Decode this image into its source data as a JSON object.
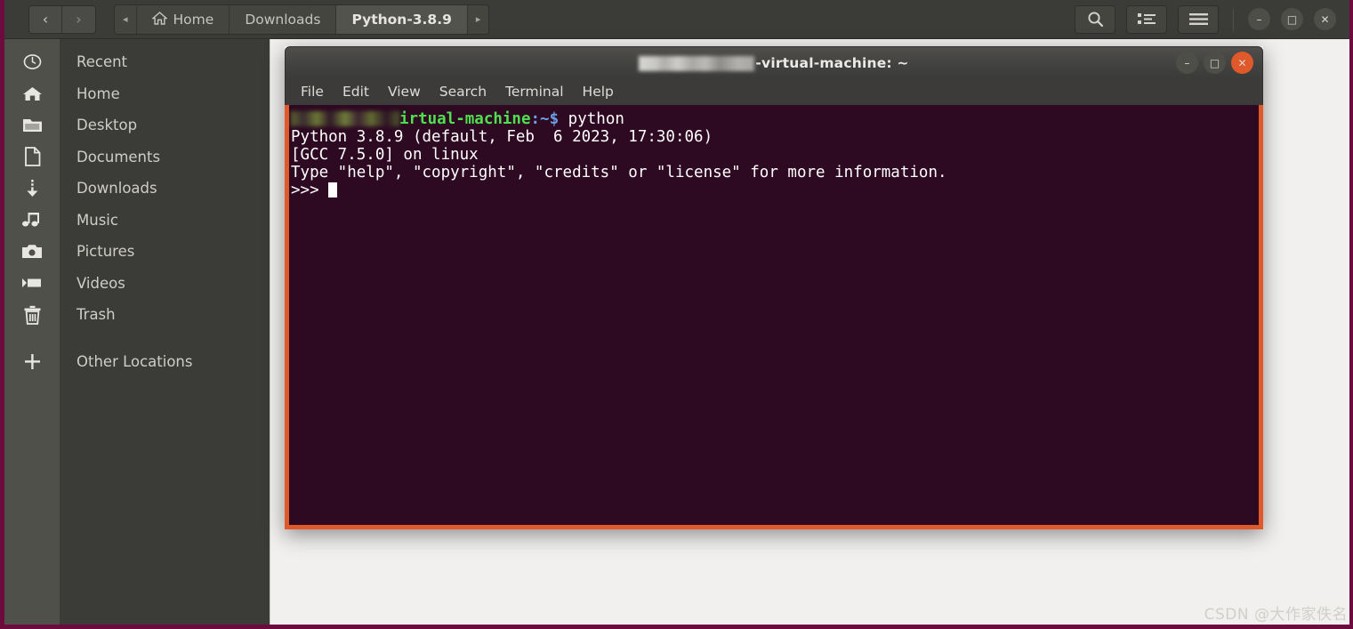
{
  "window": {
    "app": "Files",
    "background_color": "#f1f0ee",
    "frame_color": "#6d0b3e",
    "header_color": "#3b3b38"
  },
  "header": {
    "nav": {
      "back_label": "‹",
      "forward_label": "›"
    },
    "breadcrumb": {
      "prev_arrow": "◂",
      "next_arrow": "▸",
      "items": [
        {
          "label": "Home",
          "icon": "home-icon",
          "current": false
        },
        {
          "label": "Downloads",
          "icon": "",
          "current": false
        },
        {
          "label": "Python-3.8.9",
          "icon": "",
          "current": true
        }
      ]
    },
    "tools": [
      {
        "name": "search-icon",
        "label": ""
      },
      {
        "name": "view-list-icon",
        "label": ""
      },
      {
        "name": "hamburger-menu-icon",
        "label": ""
      }
    ],
    "window_controls": [
      {
        "name": "minimize-button",
        "glyph": "–"
      },
      {
        "name": "maximize-button",
        "glyph": "□"
      },
      {
        "name": "close-button",
        "glyph": "✕"
      }
    ]
  },
  "sidebar": {
    "items": [
      {
        "label": "Recent",
        "icon": "clock-icon"
      },
      {
        "label": "Home",
        "icon": "home-icon"
      },
      {
        "label": "Desktop",
        "icon": "folder-icon"
      },
      {
        "label": "Documents",
        "icon": "document-icon"
      },
      {
        "label": "Downloads",
        "icon": "download-arrow-icon"
      },
      {
        "label": "Music",
        "icon": "music-note-icon"
      },
      {
        "label": "Pictures",
        "icon": "camera-icon"
      },
      {
        "label": "Videos",
        "icon": "video-camera-icon"
      },
      {
        "label": "Trash",
        "icon": "trash-icon"
      }
    ],
    "other_locations": {
      "label": "Other Locations",
      "icon": "plus-icon"
    }
  },
  "terminal": {
    "title_prefix_redacted": true,
    "title": "-virtual-machine: ~",
    "menu": [
      "File",
      "Edit",
      "View",
      "Search",
      "Terminal",
      "Help"
    ],
    "window_controls": [
      {
        "name": "minimize-button",
        "glyph": "–"
      },
      {
        "name": "maximize-button",
        "glyph": "□"
      },
      {
        "name": "close-button",
        "glyph": "✕"
      }
    ],
    "accent_color": "#e0592a",
    "background_color": "#2d0922",
    "lines": {
      "prompt_host": "irtual-machine",
      "prompt_path": ":~$ ",
      "prompt_command": "python",
      "l2": "Python 3.8.9 (default, Feb  6 2023, 17:30:06)",
      "l3": "[GCC 7.5.0] on linux",
      "l4": "Type \"help\", \"copyright\", \"credits\" or \"license\" for more information.",
      "l5_prompt": ">>> "
    }
  },
  "watermark": {
    "text": "CSDN @大作家佚名"
  }
}
